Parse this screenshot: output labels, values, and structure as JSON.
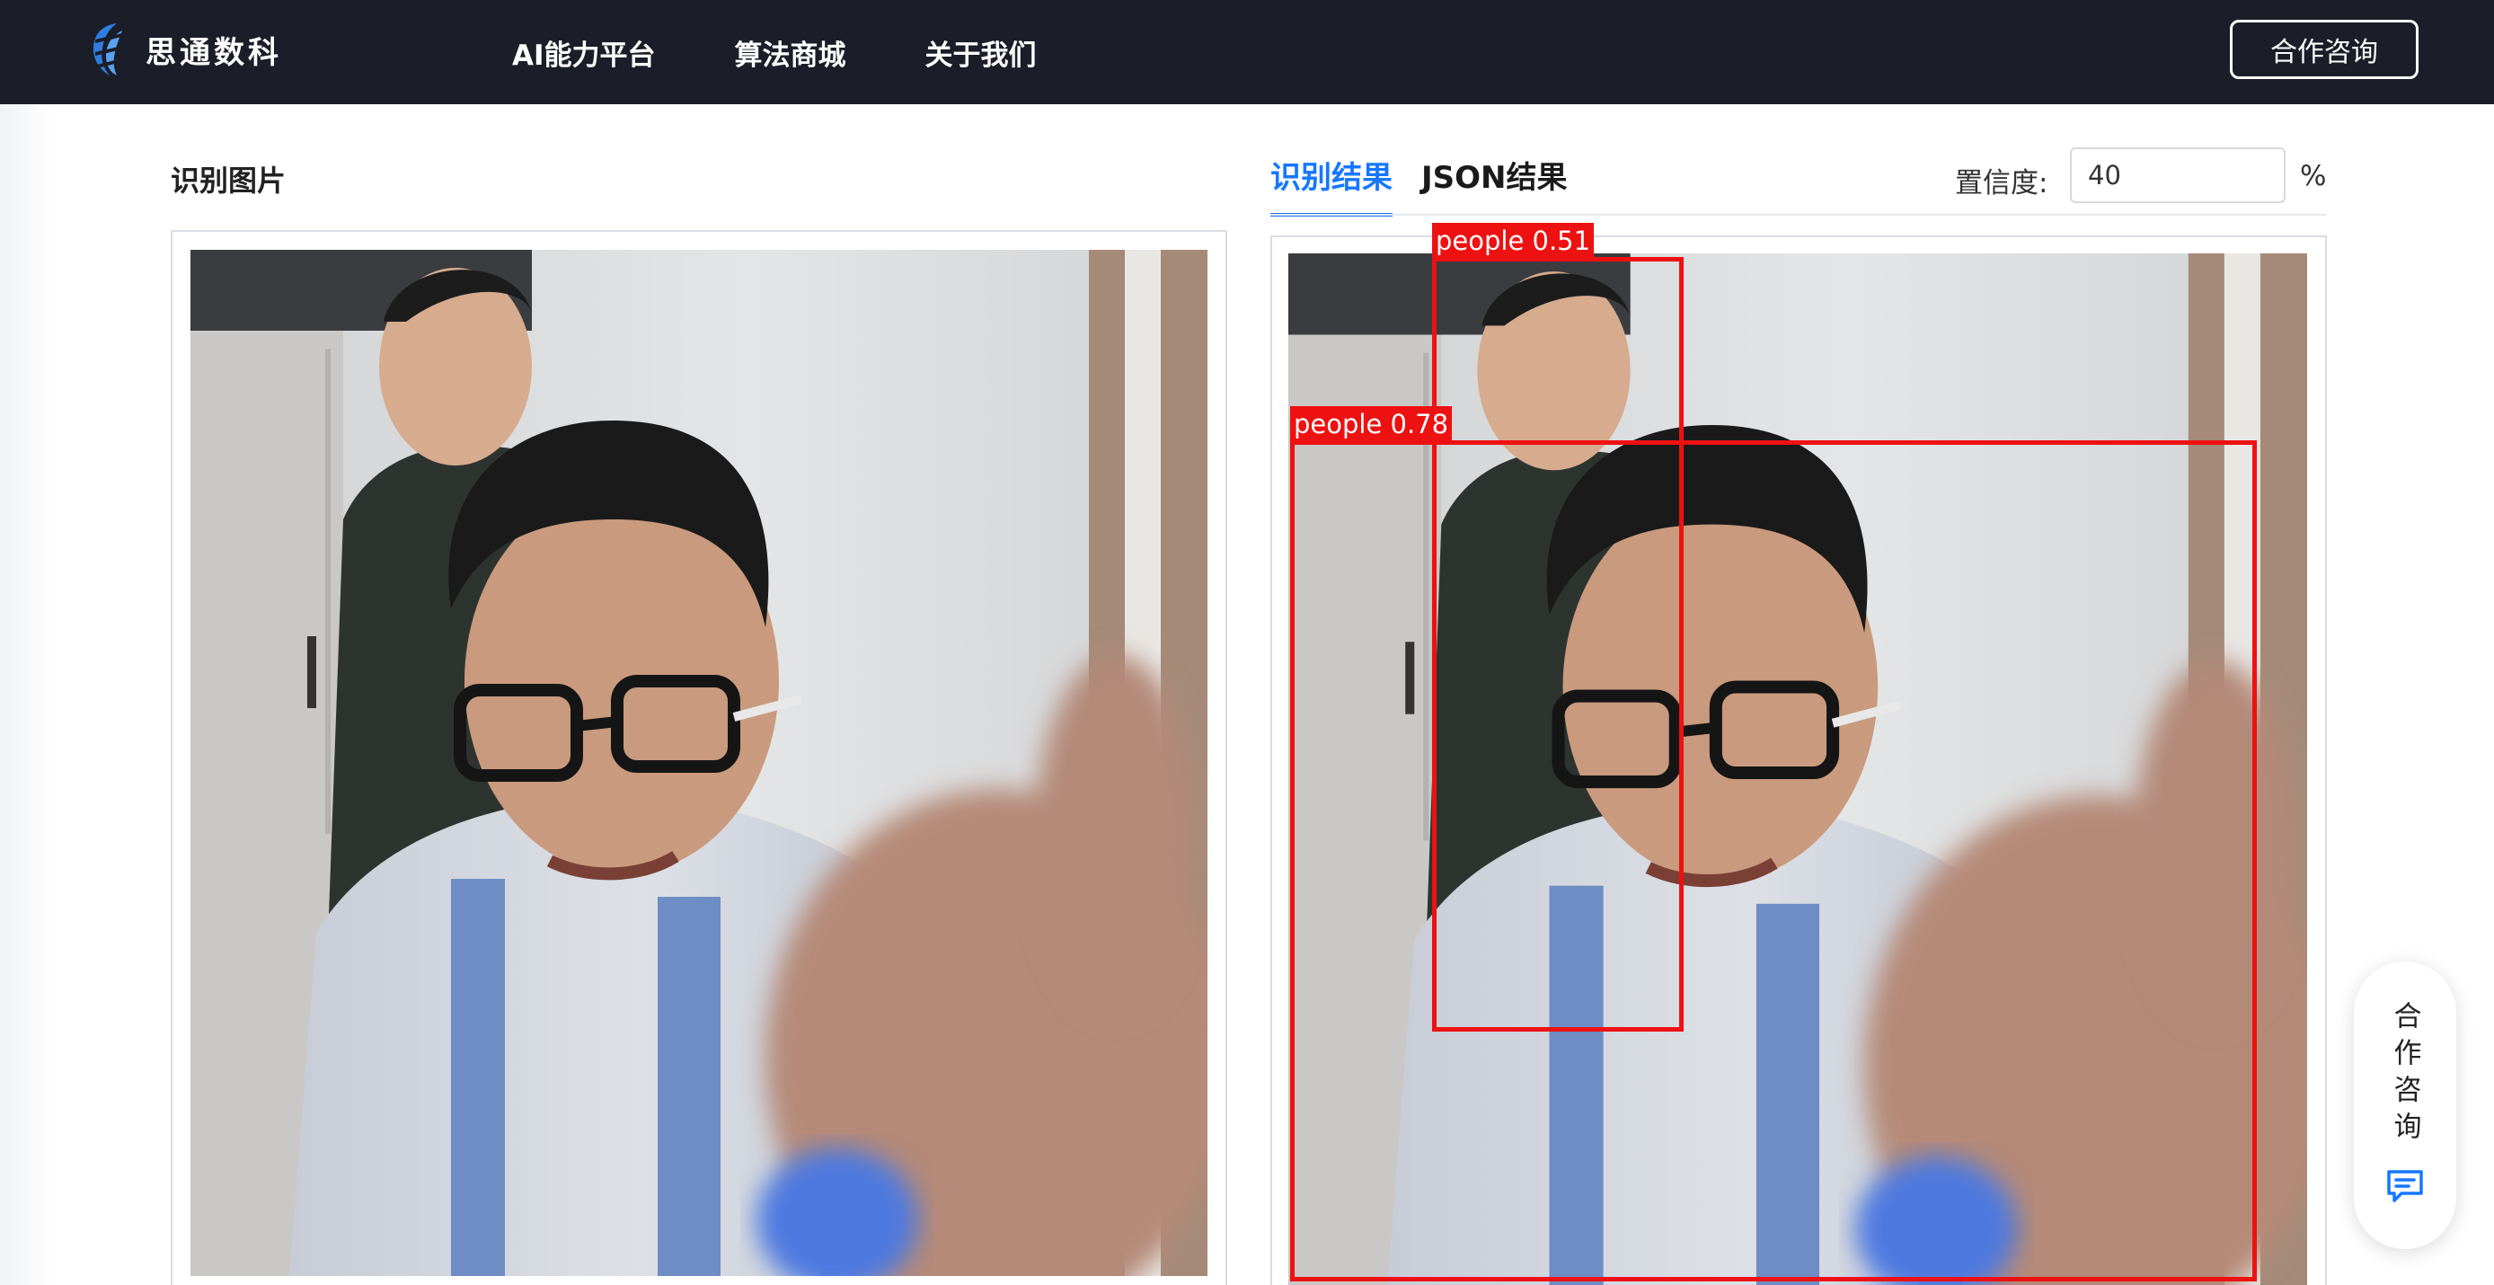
{
  "header": {
    "brand": "思通数科",
    "nav": [
      "AI能力平台",
      "算法商城",
      "关于我们"
    ],
    "consult_button": "合作咨询"
  },
  "left_panel": {
    "title": "识别图片"
  },
  "right_panel": {
    "tabs": [
      {
        "label": "识别结果",
        "active": true
      },
      {
        "label": "JSON结果",
        "active": false
      }
    ],
    "confidence_label": "置信度:",
    "confidence_value": "40",
    "confidence_unit": "%"
  },
  "detections": [
    {
      "label": "people 0.51"
    },
    {
      "label": "people 0.78"
    }
  ],
  "floating_consult": {
    "text": "合作咨询",
    "icon": "chat-icon"
  },
  "colors": {
    "header_bg": "#1b1e28",
    "accent": "#1677ff",
    "detection": "#ee1111"
  }
}
